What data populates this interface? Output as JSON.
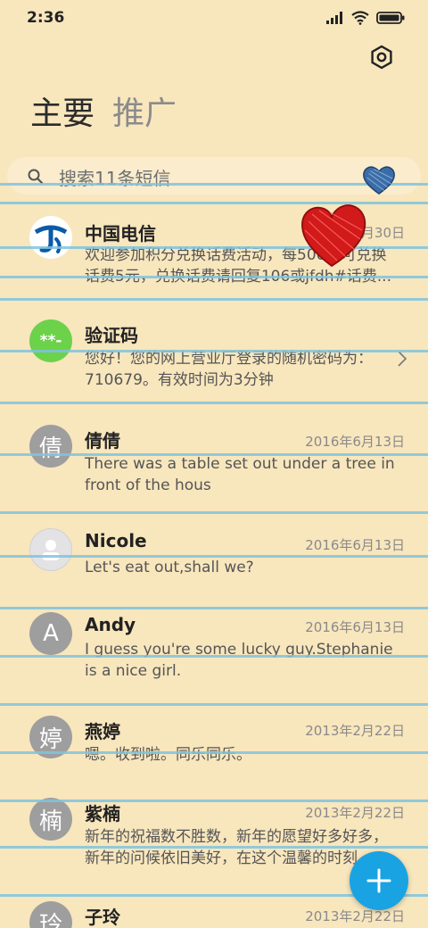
{
  "status_bar": {
    "time": "2:36"
  },
  "tabs": [
    {
      "label": "主要",
      "active": true
    },
    {
      "label": "推广",
      "active": false
    }
  ],
  "search": {
    "placeholder": "搜索11条短信"
  },
  "messages": [
    {
      "name": "中国电信",
      "date": "2016年3月30日",
      "avatar_text": "",
      "avatar_type": "china-telecom-logo",
      "preview": "欢迎参加积分兑换话费活动，每500分可兑换话费5元，兑换话费请回复106或jfdh#话费..."
    },
    {
      "name": "验证码",
      "date": "",
      "avatar_text": "**-",
      "avatar_type": "verification",
      "preview": "您好！您的网上营业厅登录的随机密码为：710679。有效时间为3分钟"
    },
    {
      "name": "倩倩",
      "date": "2016年6月13日",
      "avatar_text": "倩",
      "avatar_type": "letter",
      "preview": "There was a table set out under a tree in front of the hous"
    },
    {
      "name": "Nicole",
      "date": "2016年6月13日",
      "avatar_text": "",
      "avatar_type": "person-placeholder",
      "preview": "Let's eat out,shall we?"
    },
    {
      "name": "Andy",
      "date": "2016年6月13日",
      "avatar_text": "A",
      "avatar_type": "letter",
      "preview": "I guess you're some lucky guy.Stephanie is a nice girl."
    },
    {
      "name": "燕婷",
      "date": "2013年2月22日",
      "avatar_text": "婷",
      "avatar_type": "letter",
      "preview": "嗯。收到啦。同乐同乐。"
    },
    {
      "name": "紫楠",
      "date": "2013年2月22日",
      "avatar_text": "楠",
      "avatar_type": "letter",
      "preview": "新年的祝福数不胜数，新年的愿望好多好多，新年的问候依旧美好，在这个温馨的时刻"
    },
    {
      "name": "子玲",
      "date": "2013年2月22日",
      "avatar_text": "玲",
      "avatar_type": "letter",
      "preview": ""
    }
  ],
  "colors": {
    "background": "#f8e6bd",
    "rule_line": "#7fc3de",
    "avatar_gray": "#9e9e9e",
    "verification_green": "#6cd24a",
    "fab_blue": "#1aa3e2"
  },
  "icons": {
    "settings": "gear-icon",
    "search": "search-icon",
    "compose": "plus-icon",
    "chevron": "chevron-right-icon"
  }
}
